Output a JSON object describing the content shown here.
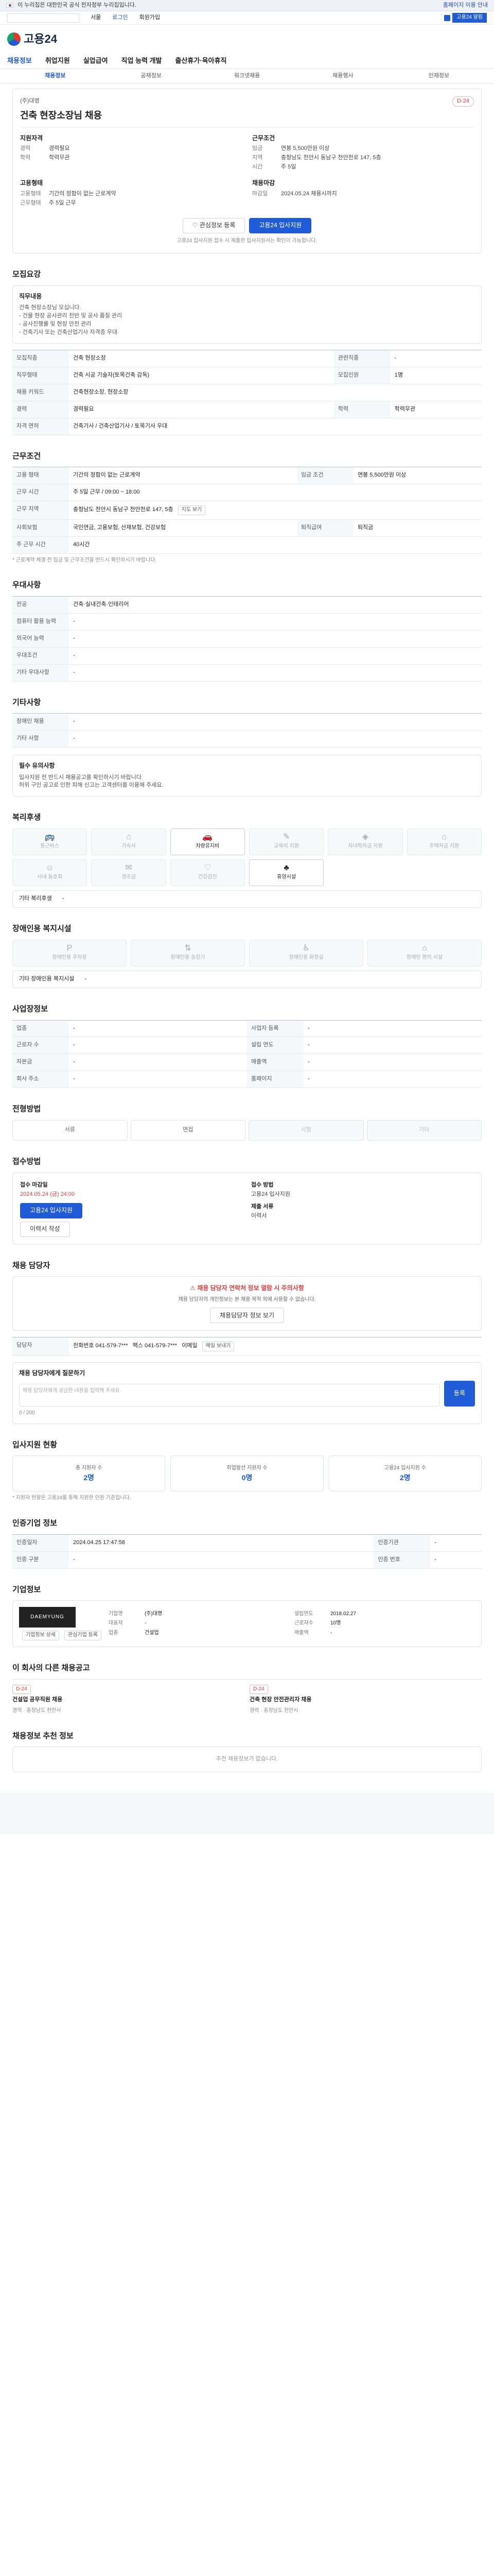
{
  "gov_bar": {
    "text": "이 누리집은 대한민국 공식 전자정부 누리집입니다.",
    "right": "홈페이지 이용 안내"
  },
  "top": {
    "location": "서울",
    "links": [
      "로그인",
      "회원가입"
    ],
    "banner": "고용24 알림"
  },
  "logo": "고용24",
  "mainnav": [
    "채용정보",
    "취업지원",
    "실업급여",
    "직업 능력 개발",
    "출산휴가·육아휴직"
  ],
  "subnav": [
    "채용정보",
    "공채정보",
    "워크넷채용",
    "채용행사",
    "인재정보"
  ],
  "job": {
    "company": "(주)대명",
    "dday": "D-24",
    "title": "건축 현장소장님 채용",
    "left_head": "지원자격",
    "right_head": "근무조건",
    "left_kv": [
      [
        "경력",
        "경력필요"
      ],
      [
        "학력",
        "학력무관"
      ]
    ],
    "right_kv": [
      [
        "임금",
        "연봉 5,500만원 이상"
      ],
      [
        "지역",
        "충청남도 천안시 동남구 천안천로 147, 5층"
      ],
      [
        "시간",
        "주 5일"
      ]
    ],
    "left2_head": "고용형태",
    "left2_kv": [
      [
        "고용형태",
        "기간의 정함이 없는 근로계약"
      ],
      [
        "근무형태",
        "주 5일 근무"
      ]
    ],
    "right2_head": "채용마감",
    "right2_kv": [
      [
        "마감일",
        "2024.05.24 채용시까지"
      ]
    ],
    "scrap": "관심정보 등록",
    "apply": "고용24 입사지원",
    "note": "고용24 입사지원 접수 시 제출한 입사지원서는 확인이 가능합니다."
  },
  "sections": {
    "recruit": "모집요강",
    "work": "근무조건",
    "other": "우대사항",
    "extra": "기타사항",
    "welfare": "복리후생",
    "disabled": "장애인용 복지시설",
    "company_info": "사업장정보",
    "selection": "전형방법",
    "apply_method": "접수방법",
    "contact": "채용 담당자",
    "stats": "입사지원 현황",
    "official": "인증기업 정보",
    "corp": "기업정보",
    "others": "이 회사의 다른 채용공고",
    "recommend": "채용정보 추천 정보"
  },
  "recruit_card": {
    "title": "직무내용",
    "lines": [
      "건축 현장소장님 모십니다.",
      "- 건물 현장 공사관리 전반 및 공사 품질 관리",
      "- 공사진행률 및 현장 안전 관리",
      "- 건축기사 또는 건축산업기사 자격증 우대"
    ]
  },
  "recruit_table": [
    [
      "모집직종",
      "건축 현장소장",
      "관련직종",
      "-"
    ],
    [
      "직무형태",
      "건축 시공 기술자(토목건축 감독)",
      "모집인원",
      "1명"
    ],
    [
      "채용 키워드",
      "건축현장소장, 현장소장",
      "",
      ""
    ],
    [
      "경력",
      "경력필요",
      "학력",
      "학력무관"
    ],
    [
      "자격 면허",
      "건축기사 / 건축산업기사 / 토목기사 우대",
      "",
      ""
    ]
  ],
  "work_table": [
    [
      "고용 형태",
      "기간의 정함이 없는 근로계약",
      "임금 조건",
      "연봉 5,500만원 이상"
    ],
    [
      "근무 시간",
      "주 5일 근무 / 09:00 ~ 18:00",
      "",
      ""
    ],
    [
      "근무 지역",
      "충청남도 천안시 동남구 천안천로 147, 5층",
      "",
      ""
    ],
    [
      "사회보험",
      "국민연금, 고용보험, 산재보험, 건강보험",
      "퇴직급여",
      "퇴직금"
    ],
    [
      "주 근무 시간",
      "40시간",
      "",
      ""
    ]
  ],
  "work_note": "* 근로계약 체결 전 임금 및 근무조건을 반드시 확인하시기 바랍니다.",
  "other_table": [
    [
      "전공",
      "건축·실내건축·인테리어"
    ],
    [
      "컴퓨터 활용 능력",
      "-"
    ],
    [
      "외국어 능력",
      "-"
    ],
    [
      "우대조건",
      "-"
    ],
    [
      "기타 우대사항",
      "-"
    ]
  ],
  "extra_table": [
    [
      "장애인 채용",
      "-"
    ],
    [
      "기타 사항",
      "-"
    ]
  ],
  "extra_box": {
    "title": "필수 유의사항",
    "lines": [
      "입사지원 전 반드시 채용공고를 확인하시기 바랍니다.",
      "허위 구인 공고로 인한 피해 신고는 고객센터를 이용해 주세요."
    ]
  },
  "welfare_tiles": [
    {
      "label": "통근버스",
      "icon": "bus-icon",
      "on": false
    },
    {
      "label": "기숙사",
      "icon": "bed-icon",
      "on": false
    },
    {
      "label": "차량유지비",
      "icon": "car-icon",
      "on": true
    },
    {
      "label": "교육비 지원",
      "icon": "book-icon",
      "on": false
    },
    {
      "label": "자녀학자금 지원",
      "icon": "cap-icon",
      "on": false
    },
    {
      "label": "주택자금 지원",
      "icon": "house-icon",
      "on": false
    },
    {
      "label": "사내 동호회",
      "icon": "people-icon",
      "on": false
    },
    {
      "label": "경조금",
      "icon": "gift-icon",
      "on": false
    },
    {
      "label": "건강검진",
      "icon": "heart-icon",
      "on": false
    },
    {
      "label": "휴양시설",
      "icon": "tree-icon",
      "on": true
    }
  ],
  "welfare_row": {
    "label": "기타 복리후생",
    "value": "-"
  },
  "disabled_tiles": [
    "장애인용 주차장",
    "장애인용 승강기",
    "장애인용 화장실",
    "장애인 편의 시설"
  ],
  "disabled_row": {
    "label": "기타 장애인용 복지시설",
    "value": "-"
  },
  "company_table": [
    [
      "업종",
      "-",
      "사업자 등록",
      "-"
    ],
    [
      "근로자 수",
      "-",
      "설립 연도",
      "-"
    ],
    [
      "자본금",
      "-",
      "매출액",
      "-"
    ],
    [
      "회사 주소",
      "-",
      "홈페이지",
      "-"
    ]
  ],
  "selection_steps": [
    "서류",
    "면접",
    "시험",
    "기타"
  ],
  "apply_card": {
    "label1": "접수 마감일",
    "deadline": "2024.05.24 (금) 24:00",
    "method_label": "접수 방법",
    "method": "고용24 입사지원",
    "apply_btn": "고용24 입사지원",
    "docs_label": "제출 서류",
    "docs": "이력서",
    "extra_btn": "이력서 작성"
  },
  "contact": {
    "warn": "채용 담당자 연락처 정보 열람 시 주의사항",
    "text": "채용 담당자의 개인정보는 본 채용 목적 외에 사용할 수 없습니다.",
    "btn": "채용담당자 정보 보기",
    "person": "담당자",
    "phone_label": "전화번호",
    "phone": "041-579-7***",
    "fax_label": "팩스",
    "fax": "041-579-7***",
    "email_label": "이메일",
    "email_btn": "메일 보내기",
    "qa_title": "채용 담당자에게 질문하기",
    "qa_placeholder": "채용 담당자에게 궁금한 내용을 입력해 주세요.",
    "qa_btn": "등록",
    "counter": "0 / 200"
  },
  "stats": [
    {
      "label": "총 지원자 수",
      "value": "2명"
    },
    {
      "label": "취업알선 지원자 수",
      "value": "0명"
    },
    {
      "label": "고용24 입사지원 수",
      "value": "2명"
    }
  ],
  "stats_note": "* 지원자 현황은 고용24를 통해 지원한 인원 기준입니다.",
  "official_table": [
    [
      "인증일자",
      "2024.04.25 17:47:58",
      "인증기관",
      "-"
    ],
    [
      "인증 구분",
      "-",
      "인증 번호",
      "-"
    ]
  ],
  "corp": {
    "logo": "DAEMYUNG",
    "kv": [
      [
        "기업명",
        "(주)대명",
        "설립연도",
        "2018.02.27"
      ],
      [
        "대표자",
        "-",
        "근로자수",
        "10명"
      ],
      [
        "업종",
        "건설업",
        "매출액",
        "-"
      ]
    ],
    "btn1": "기업정보 상세",
    "btn2": "관심기업 등록"
  },
  "others_items": [
    {
      "dday": "D-24",
      "title": "건설업 공무직원 채용",
      "meta": "경력 · 충청남도 천안시"
    },
    {
      "dday": "D-24",
      "title": "건축 현장 안전관리자 채용",
      "meta": "경력 · 충청남도 천안시"
    }
  ],
  "recommend_empty": "추천 채용정보가 없습니다."
}
